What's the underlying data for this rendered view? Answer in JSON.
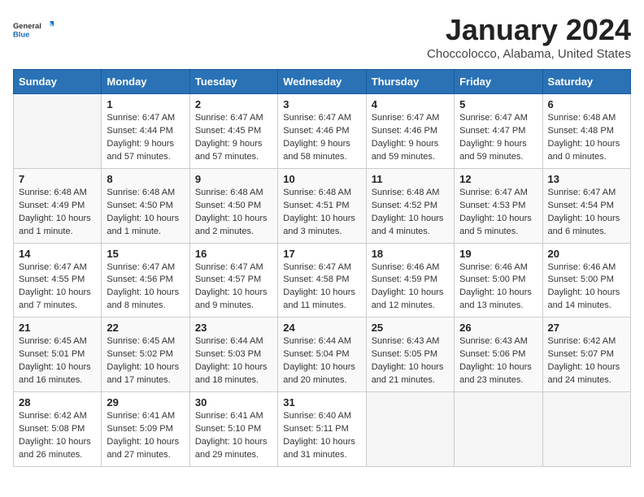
{
  "logo": {
    "line1": "General",
    "line2": "Blue"
  },
  "title": "January 2024",
  "subtitle": "Choccolocco, Alabama, United States",
  "weekdays": [
    "Sunday",
    "Monday",
    "Tuesday",
    "Wednesday",
    "Thursday",
    "Friday",
    "Saturday"
  ],
  "weeks": [
    [
      {
        "day": "",
        "info": ""
      },
      {
        "day": "1",
        "info": "Sunrise: 6:47 AM\nSunset: 4:44 PM\nDaylight: 9 hours\nand 57 minutes."
      },
      {
        "day": "2",
        "info": "Sunrise: 6:47 AM\nSunset: 4:45 PM\nDaylight: 9 hours\nand 57 minutes."
      },
      {
        "day": "3",
        "info": "Sunrise: 6:47 AM\nSunset: 4:46 PM\nDaylight: 9 hours\nand 58 minutes."
      },
      {
        "day": "4",
        "info": "Sunrise: 6:47 AM\nSunset: 4:46 PM\nDaylight: 9 hours\nand 59 minutes."
      },
      {
        "day": "5",
        "info": "Sunrise: 6:47 AM\nSunset: 4:47 PM\nDaylight: 9 hours\nand 59 minutes."
      },
      {
        "day": "6",
        "info": "Sunrise: 6:48 AM\nSunset: 4:48 PM\nDaylight: 10 hours\nand 0 minutes."
      }
    ],
    [
      {
        "day": "7",
        "info": "Sunrise: 6:48 AM\nSunset: 4:49 PM\nDaylight: 10 hours\nand 1 minute."
      },
      {
        "day": "8",
        "info": "Sunrise: 6:48 AM\nSunset: 4:50 PM\nDaylight: 10 hours\nand 1 minute."
      },
      {
        "day": "9",
        "info": "Sunrise: 6:48 AM\nSunset: 4:50 PM\nDaylight: 10 hours\nand 2 minutes."
      },
      {
        "day": "10",
        "info": "Sunrise: 6:48 AM\nSunset: 4:51 PM\nDaylight: 10 hours\nand 3 minutes."
      },
      {
        "day": "11",
        "info": "Sunrise: 6:48 AM\nSunset: 4:52 PM\nDaylight: 10 hours\nand 4 minutes."
      },
      {
        "day": "12",
        "info": "Sunrise: 6:47 AM\nSunset: 4:53 PM\nDaylight: 10 hours\nand 5 minutes."
      },
      {
        "day": "13",
        "info": "Sunrise: 6:47 AM\nSunset: 4:54 PM\nDaylight: 10 hours\nand 6 minutes."
      }
    ],
    [
      {
        "day": "14",
        "info": "Sunrise: 6:47 AM\nSunset: 4:55 PM\nDaylight: 10 hours\nand 7 minutes."
      },
      {
        "day": "15",
        "info": "Sunrise: 6:47 AM\nSunset: 4:56 PM\nDaylight: 10 hours\nand 8 minutes."
      },
      {
        "day": "16",
        "info": "Sunrise: 6:47 AM\nSunset: 4:57 PM\nDaylight: 10 hours\nand 9 minutes."
      },
      {
        "day": "17",
        "info": "Sunrise: 6:47 AM\nSunset: 4:58 PM\nDaylight: 10 hours\nand 11 minutes."
      },
      {
        "day": "18",
        "info": "Sunrise: 6:46 AM\nSunset: 4:59 PM\nDaylight: 10 hours\nand 12 minutes."
      },
      {
        "day": "19",
        "info": "Sunrise: 6:46 AM\nSunset: 5:00 PM\nDaylight: 10 hours\nand 13 minutes."
      },
      {
        "day": "20",
        "info": "Sunrise: 6:46 AM\nSunset: 5:00 PM\nDaylight: 10 hours\nand 14 minutes."
      }
    ],
    [
      {
        "day": "21",
        "info": "Sunrise: 6:45 AM\nSunset: 5:01 PM\nDaylight: 10 hours\nand 16 minutes."
      },
      {
        "day": "22",
        "info": "Sunrise: 6:45 AM\nSunset: 5:02 PM\nDaylight: 10 hours\nand 17 minutes."
      },
      {
        "day": "23",
        "info": "Sunrise: 6:44 AM\nSunset: 5:03 PM\nDaylight: 10 hours\nand 18 minutes."
      },
      {
        "day": "24",
        "info": "Sunrise: 6:44 AM\nSunset: 5:04 PM\nDaylight: 10 hours\nand 20 minutes."
      },
      {
        "day": "25",
        "info": "Sunrise: 6:43 AM\nSunset: 5:05 PM\nDaylight: 10 hours\nand 21 minutes."
      },
      {
        "day": "26",
        "info": "Sunrise: 6:43 AM\nSunset: 5:06 PM\nDaylight: 10 hours\nand 23 minutes."
      },
      {
        "day": "27",
        "info": "Sunrise: 6:42 AM\nSunset: 5:07 PM\nDaylight: 10 hours\nand 24 minutes."
      }
    ],
    [
      {
        "day": "28",
        "info": "Sunrise: 6:42 AM\nSunset: 5:08 PM\nDaylight: 10 hours\nand 26 minutes."
      },
      {
        "day": "29",
        "info": "Sunrise: 6:41 AM\nSunset: 5:09 PM\nDaylight: 10 hours\nand 27 minutes."
      },
      {
        "day": "30",
        "info": "Sunrise: 6:41 AM\nSunset: 5:10 PM\nDaylight: 10 hours\nand 29 minutes."
      },
      {
        "day": "31",
        "info": "Sunrise: 6:40 AM\nSunset: 5:11 PM\nDaylight: 10 hours\nand 31 minutes."
      },
      {
        "day": "",
        "info": ""
      },
      {
        "day": "",
        "info": ""
      },
      {
        "day": "",
        "info": ""
      }
    ]
  ]
}
